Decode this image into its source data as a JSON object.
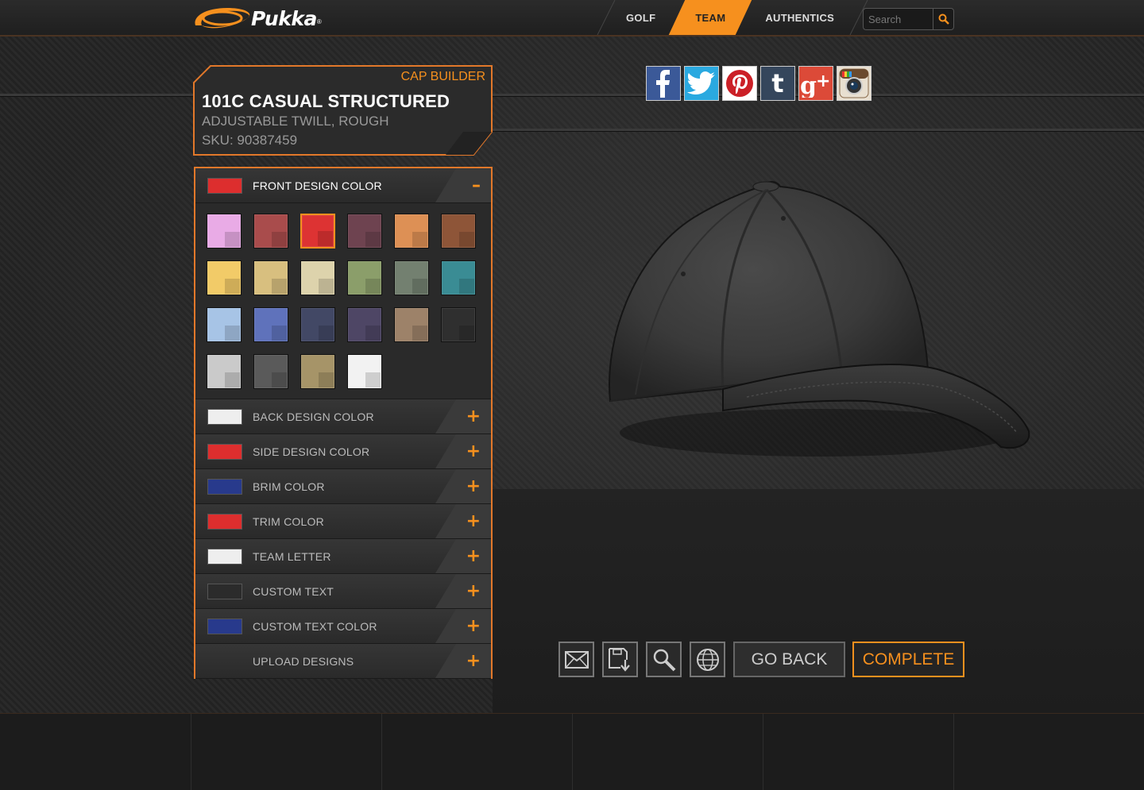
{
  "header": {
    "brand": "Pukka",
    "brand_mark": "®",
    "nav": [
      {
        "label": "GOLF",
        "active": false
      },
      {
        "label": "TEAM",
        "active": true
      },
      {
        "label": "AUTHENTICS",
        "active": false
      }
    ],
    "search": {
      "placeholder": "Search",
      "value": "",
      "icon": "magnifier-icon"
    }
  },
  "product": {
    "builder_label": "CAP BUILDER",
    "name": "101C CASUAL STRUCTURED",
    "description": "ADJUSTABLE TWILL, ROUGH",
    "sku": "SKU: 90387459"
  },
  "colors": {
    "accent": "#f6901e",
    "palette": [
      "#e9abe6",
      "#a94c4c",
      "#dd3333",
      "#6e4350",
      "#dd9055",
      "#8e5538",
      "#f2cb68",
      "#d8bf7f",
      "#ddd3ac",
      "#8b9e6a",
      "#738070",
      "#3a8c94",
      "#a7c4e6",
      "#5f72bb",
      "#424865",
      "#4e4665",
      "#9d8269",
      "#2f2f2f",
      "#cacaca",
      "#5a5a5a",
      "#a69468",
      "#f2f2f2"
    ],
    "selected_index": 2
  },
  "sections": [
    {
      "label": "FRONT DESIGN COLOR",
      "chip": "#dd2e2e",
      "open": true,
      "toggle": "–"
    },
    {
      "label": "BACK DESIGN COLOR",
      "chip": "#eeeeee",
      "open": false,
      "toggle": "+"
    },
    {
      "label": "SIDE DESIGN COLOR",
      "chip": "#dd2e2e",
      "open": false,
      "toggle": "+"
    },
    {
      "label": "BRIM COLOR",
      "chip": "#283a8c",
      "open": false,
      "toggle": "+"
    },
    {
      "label": "TRIM COLOR",
      "chip": "#dd2e2e",
      "open": false,
      "toggle": "+"
    },
    {
      "label": "TEAM LETTER",
      "chip": "#eeeeee",
      "open": false,
      "toggle": "+"
    },
    {
      "label": "CUSTOM TEXT",
      "chip": "#2b2b2b",
      "open": false,
      "toggle": "+"
    },
    {
      "label": "CUSTOM TEXT COLOR",
      "chip": "#283a8c",
      "open": false,
      "toggle": "+"
    },
    {
      "label": "UPLOAD DESIGNS",
      "chip": "",
      "open": false,
      "toggle": "+"
    }
  ],
  "social": [
    "facebook-icon",
    "twitter-icon",
    "pinterest-icon",
    "tumblr-icon",
    "google-plus-icon",
    "instagram-icon"
  ],
  "actions": {
    "icons": [
      "email-icon",
      "save-icon",
      "zoom-icon",
      "globe-icon"
    ],
    "go_back": "GO BACK",
    "complete": "COMPLETE"
  }
}
